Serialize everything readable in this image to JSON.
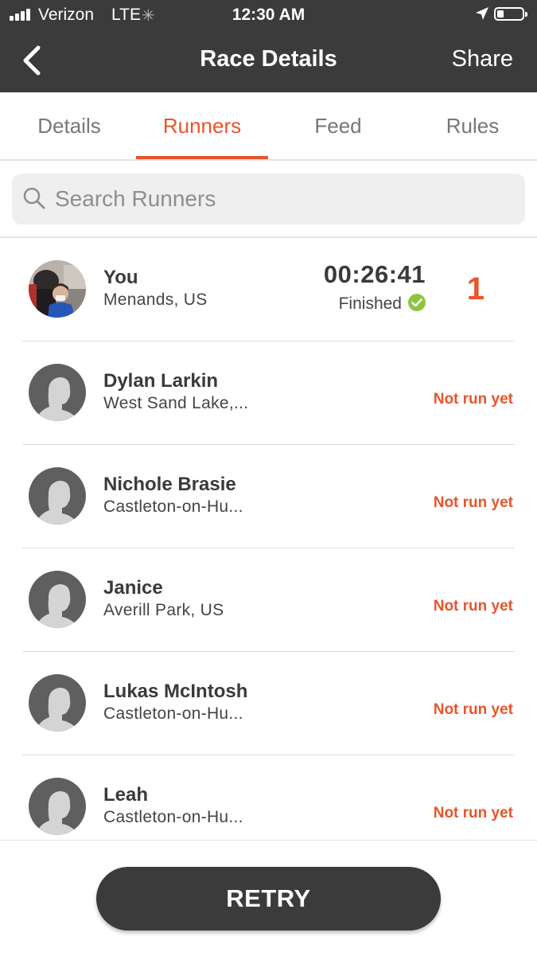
{
  "status_bar": {
    "carrier": "Verizon",
    "network": "LTE",
    "time": "12:30 AM",
    "battery_level": 0.2
  },
  "nav": {
    "back_icon": "chevron-left-icon",
    "title": "Race Details",
    "share_label": "Share"
  },
  "tabs": [
    {
      "label": "Details",
      "active": false
    },
    {
      "label": "Runners",
      "active": true
    },
    {
      "label": "Feed",
      "active": false
    },
    {
      "label": "Rules",
      "active": false
    }
  ],
  "search": {
    "placeholder": "Search Runners",
    "value": ""
  },
  "runners": [
    {
      "name": "You",
      "location": "Menands, US",
      "time": "00:26:41",
      "status": "Finished",
      "rank": "1",
      "avatar": "user-photo"
    },
    {
      "name": "Dylan Larkin",
      "location": "West Sand Lake,...",
      "status": "Not run yet",
      "avatar": "default-avatar"
    },
    {
      "name": "Nichole Brasie",
      "location": "Castleton-on-Hu...",
      "status": "Not run yet",
      "avatar": "default-avatar"
    },
    {
      "name": "Janice",
      "location": "Averill Park, US",
      "status": "Not run yet",
      "avatar": "default-avatar"
    },
    {
      "name": "Lukas McIntosh",
      "location": "Castleton-on-Hu...",
      "status": "Not run yet",
      "avatar": "default-avatar"
    },
    {
      "name": "Leah",
      "location": "Castleton-on-Hu...",
      "status": "Not run yet",
      "avatar": "default-avatar"
    }
  ],
  "footer": {
    "retry_label": "RETRY"
  },
  "colors": {
    "accent": "#e9542a",
    "header_bg": "#3b3b3b",
    "finished_check": "#8cc63f"
  }
}
